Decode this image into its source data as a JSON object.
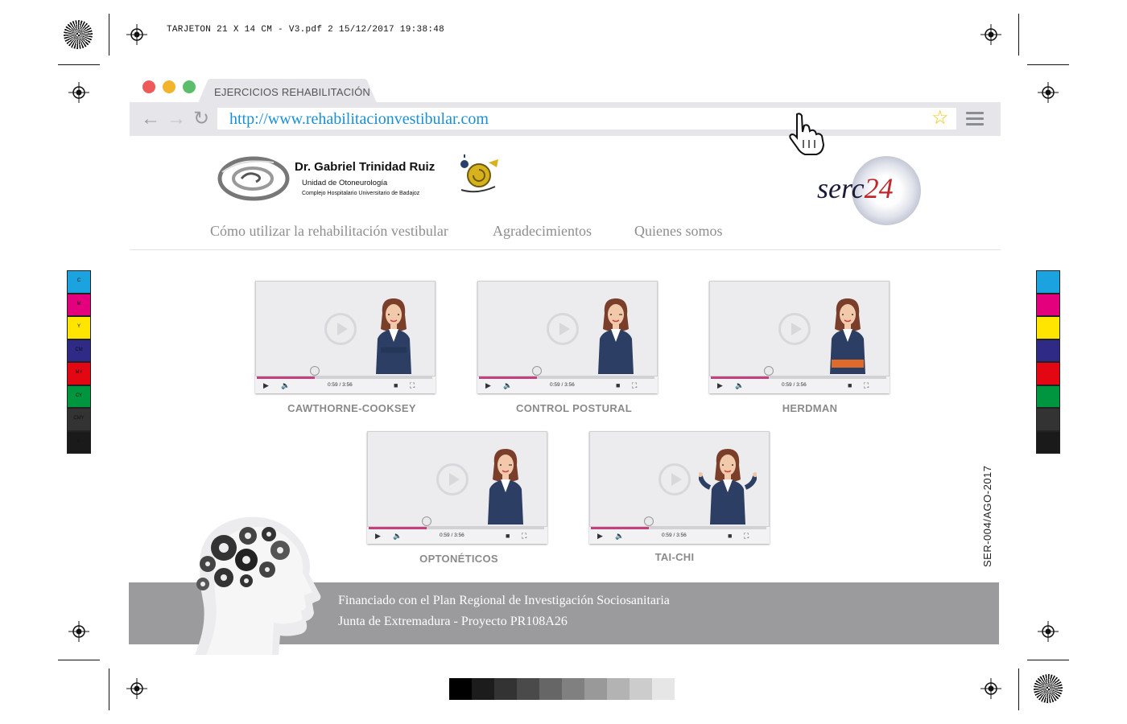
{
  "print": {
    "header": "TARJETON 21 X 14 CM - V3.pdf   2   15/12/2017   19:38:48",
    "side_code": "SER-004/AGO-2017",
    "color_bar_labels": [
      "C",
      "M",
      "Y",
      "CM",
      "MY",
      "CY",
      "CMY",
      "K"
    ],
    "color_bar_colors": [
      "#1aa3de",
      "#e4007c",
      "#ffe500",
      "#2e2a86",
      "#e30613",
      "#009640",
      "#333333",
      "#1a1a1a"
    ],
    "gray_ramp": [
      "#000000",
      "#1c1c1c",
      "#333333",
      "#4a4a4a",
      "#666666",
      "#808080",
      "#999999",
      "#b3b3b3",
      "#cccccc",
      "#e6e6e6"
    ]
  },
  "browser": {
    "tab_label": "EJERCICIOS REHABILITACIÓN",
    "url": "http://www.rehabilitacionvestibular.com",
    "traffic_lights": [
      "#ee5a5a",
      "#f2b32d",
      "#5cbd6a"
    ],
    "icons": [
      "back-arrow-icon",
      "forward-arrow-icon",
      "reload-icon",
      "star-icon",
      "menu-icon",
      "hand-cursor-icon"
    ]
  },
  "header": {
    "doctor_name": "Dr. Gabriel Trinidad Ruiz",
    "unit": "Unidad de Otoneurología",
    "hospital": "Complejo Hospitalario Universitario de Badajoz",
    "serc_text": "serc",
    "serc_number": "24"
  },
  "nav": {
    "items": [
      "Cómo utilizar la rehabilitación vestibular",
      "Agradecimientos",
      "Quienes somos"
    ]
  },
  "videos": [
    {
      "title": "CAWTHORNE-COOKSEY",
      "time": "0:59 / 3:56",
      "progress": 0.33
    },
    {
      "title": "CONTROL POSTURAL",
      "time": "0:59 / 3:56",
      "progress": 0.33
    },
    {
      "title": "HERDMAN",
      "time": "0:59 / 3:56",
      "progress": 0.33
    },
    {
      "title": "OPTONÉTICOS",
      "time": "0:59 / 3:56",
      "progress": 0.33
    },
    {
      "title": "TAI-CHI",
      "time": "0:59 / 3:56",
      "progress": 0.33
    }
  ],
  "footer": {
    "line1": "Financiado con el Plan Regional de Investigación Sociosanitaria",
    "line2": "Junta de Extremadura - Proyecto PR108A26"
  }
}
